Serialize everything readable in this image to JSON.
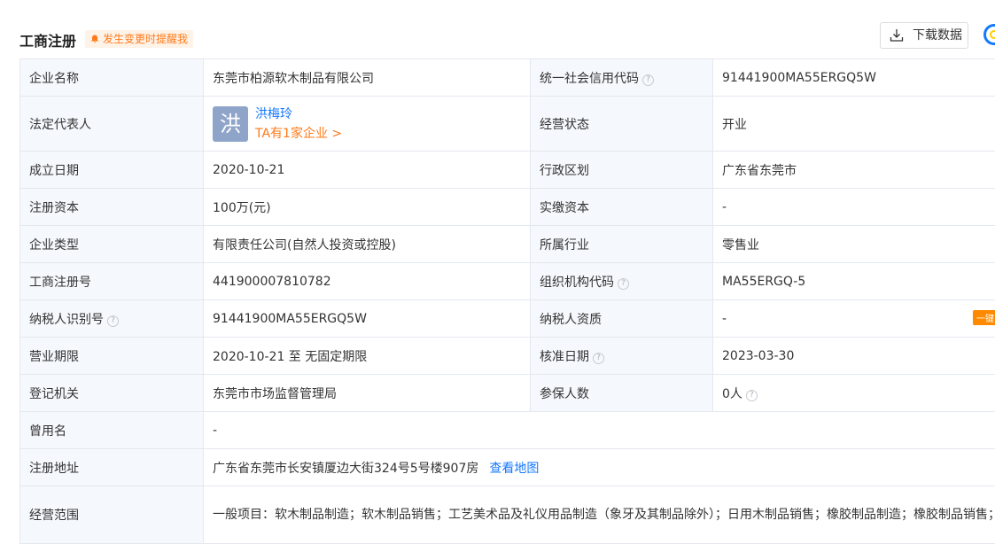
{
  "header": {
    "title": "工商注册",
    "remind_label": "发生变更时提醒我",
    "download_label": "下载数据"
  },
  "rows": [
    {
      "l1": "企业名称",
      "v1": "东莞市柏源软木制品有限公司",
      "l2": "统一社会信用代码",
      "v2": "91441900MA55ERGQ5W"
    },
    {
      "l1": "法定代表人",
      "avatar": "洪",
      "rep_name": "洪梅玲",
      "rep_link": "TA有1家企业 >",
      "l2": "经营状态",
      "v2": "开业"
    },
    {
      "l1": "成立日期",
      "v1": "2020-10-21",
      "l2": "行政区划",
      "v2": "广东省东莞市"
    },
    {
      "l1": "注册资本",
      "v1": "100万(元)",
      "l2": "实缴资本",
      "v2": "-"
    },
    {
      "l1": "企业类型",
      "v1": "有限责任公司(自然人投资或控股)",
      "l2": "所属行业",
      "v2": "零售业"
    },
    {
      "l1": "工商注册号",
      "v1": "441900007810782",
      "l2": "组织机构代码",
      "v2": "MA55ERGQ-5"
    },
    {
      "l1": "纳税人识别号",
      "v1": "91441900MA55ERGQ5W",
      "l2": "纳税人资质",
      "v2": "-"
    },
    {
      "l1": "营业期限",
      "v1": "2020-10-21 至 无固定期限",
      "l2": "核准日期",
      "v2": "2023-03-30"
    },
    {
      "l1": "登记机关",
      "v1": "东莞市市场监督管理局",
      "l2": "参保人数",
      "v2": "0人"
    },
    {
      "l1": "曾用名",
      "v1": "-"
    },
    {
      "l1": "注册地址",
      "v1": "广东省东莞市长安镇厦边大街324号5号楼907房",
      "map_link": "查看地图"
    },
    {
      "l1": "经营范围",
      "v1": "一般项目：软木制品制造；软木制品销售；工艺美术品及礼仪用品制造（象牙及其制品除外）；日用木制品销售；橡胶制品制造；橡胶制品销售；建筑装饰材料销售；包装材料及制品销售。（除依法须经批准的项目外，凭营业执照依法自主开展经营活动）"
    }
  ],
  "tag_label": "一键",
  "help_glyph": "?"
}
